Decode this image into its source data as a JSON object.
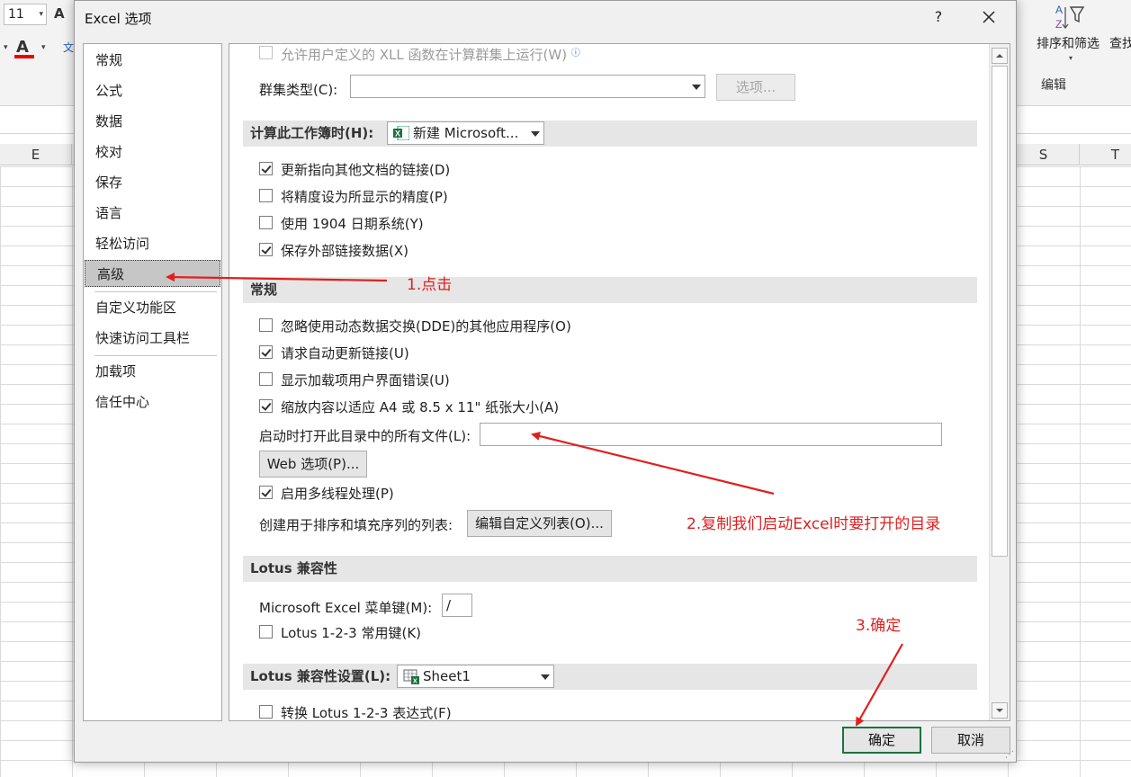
{
  "excel": {
    "font_size": "11",
    "font_size_dropdown_glyph": "▾",
    "grow_font_glyph": "A",
    "font_color_glyph": "A",
    "dropdown_glyph": "▾",
    "pinyin_glyph": "文",
    "sort_filter_label": "排序和筛选",
    "find_select_label": "查找",
    "editing_group_label": "编辑",
    "columns": [
      "E",
      "S",
      "T"
    ]
  },
  "dialog": {
    "title": "Excel 选项",
    "help_glyph": "?",
    "nav_items": [
      "常规",
      "公式",
      "数据",
      "校对",
      "保存",
      "语言",
      "轻松访问",
      "高级",
      "自定义功能区",
      "快速访问工具栏",
      "加载项",
      "信任中心"
    ],
    "active_nav": "高级",
    "content": {
      "xll_row": "允许用户定义的 XLL 函数在计算群集上运行(W)",
      "info_glyph": "ⓘ",
      "cluster_type_label": "群集类型(C):",
      "cluster_type_value": "",
      "options_button": "选项...",
      "calc_workbook_header": "计算此工作簿时(H):",
      "calc_workbook_value": "新建 Microsoft...",
      "calc_options": [
        {
          "label": "更新指向其他文档的链接(D)",
          "checked": true
        },
        {
          "label": "将精度设为所显示的精度(P)",
          "checked": false
        },
        {
          "label": "使用 1904 日期系统(Y)",
          "checked": false
        },
        {
          "label": "保存外部链接数据(X)",
          "checked": true
        }
      ],
      "general_header": "常规",
      "general_options": [
        {
          "label": "忽略使用动态数据交换(DDE)的其他应用程序(O)",
          "checked": false
        },
        {
          "label": "请求自动更新链接(U)",
          "checked": true
        },
        {
          "label": "显示加载项用户界面错误(U)",
          "checked": false
        },
        {
          "label": "缩放内容以适应 A4 或 8.5 x 11\" 纸张大小(A)",
          "checked": true
        }
      ],
      "startup_dir_label": "启动时打开此目录中的所有文件(L):",
      "startup_dir_value": "",
      "web_options_button": "Web 选项(P)...",
      "multithread_label": "启用多线程处理(P)",
      "multithread_checked": true,
      "custom_lists_label": "创建用于排序和填充序列的列表:",
      "custom_lists_button": "编辑自定义列表(O)...",
      "lotus_header": "Lotus 兼容性",
      "menu_key_label": "Microsoft Excel 菜单键(M):",
      "menu_key_value": "/",
      "lotus_keys_label": "Lotus 1-2-3 常用键(K)",
      "lotus_keys_checked": false,
      "lotus_settings_header": "Lotus 兼容性设置(L):",
      "lotus_settings_value": "Sheet1",
      "lotus_formula_label": "转换 Lotus 1-2-3 表达式(F)",
      "lotus_formula_checked": false
    },
    "ok_button": "确定",
    "cancel_button": "取消"
  },
  "annotations": {
    "step1": "1.点击",
    "step2": "2.复制我们启动Excel时要打开的目录",
    "step3": "3.确定",
    "color": "#e02020"
  }
}
